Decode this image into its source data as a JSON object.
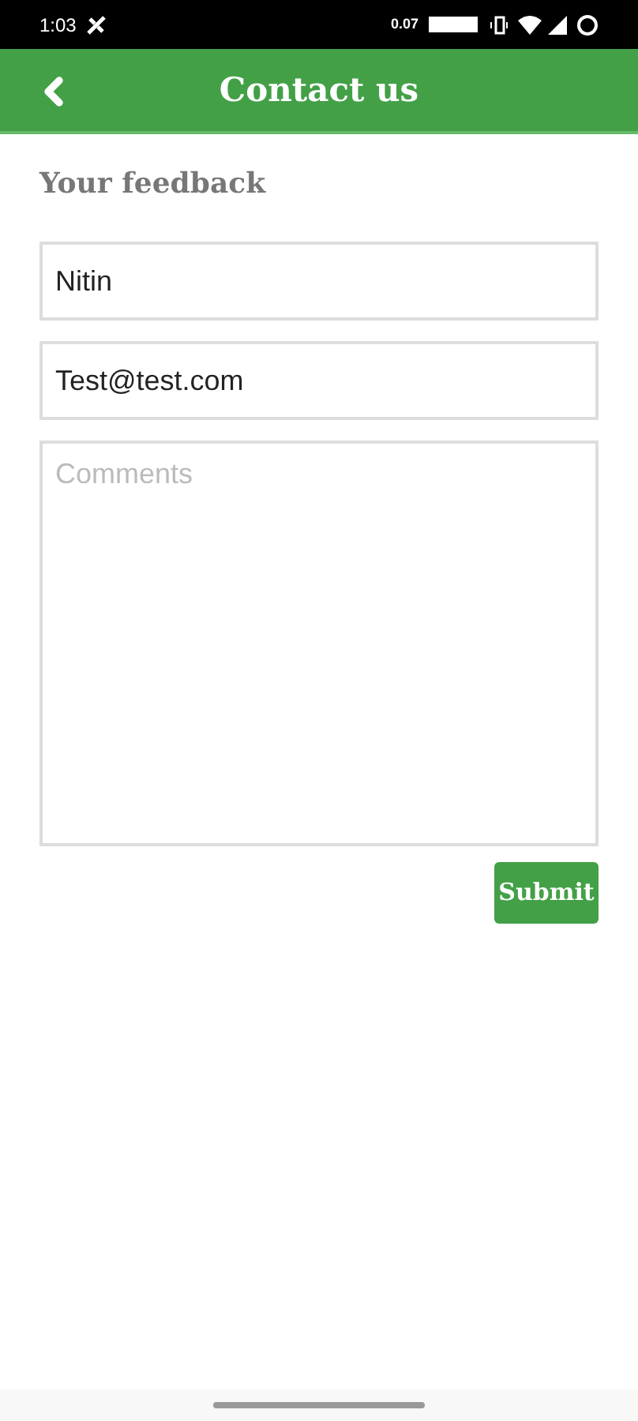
{
  "status_bar": {
    "time": "1:03",
    "speed": "0.07"
  },
  "header": {
    "title": "Contact us"
  },
  "section_title": "Your feedback",
  "fields": [
    {
      "value": "Nitin"
    },
    {
      "value": "Test@test.com"
    }
  ],
  "comments": {
    "placeholder": "Comments"
  },
  "submit": "Submit"
}
